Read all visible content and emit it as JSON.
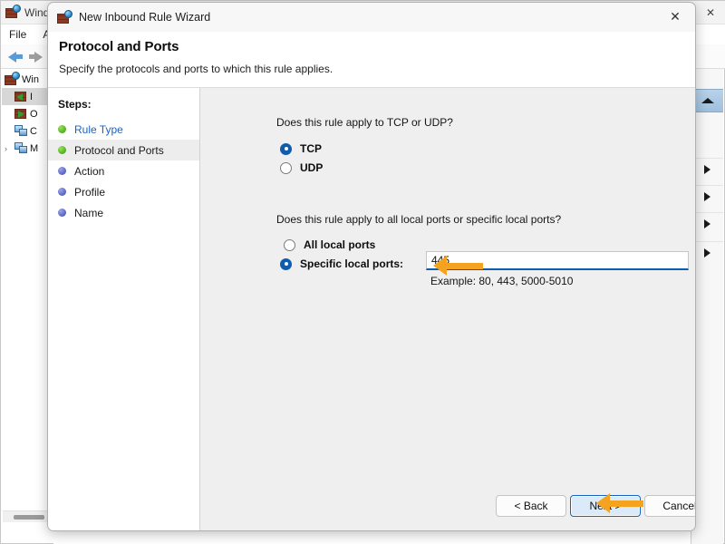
{
  "console": {
    "title": "Wind",
    "icon": "firewall-icon",
    "close_label": "✕",
    "menus": [
      "File",
      "A"
    ],
    "nav": {
      "back": "back-arrow-icon",
      "forward": "forward-arrow-icon"
    },
    "tree": {
      "root": "Win",
      "nodes": [
        {
          "label": "I",
          "icon": "inbound-rules-icon",
          "selected": true,
          "expander": ""
        },
        {
          "label": "O",
          "icon": "outbound-rules-icon",
          "selected": false,
          "expander": ""
        },
        {
          "label": "C",
          "icon": "connection-security-icon",
          "selected": false,
          "expander": ""
        },
        {
          "label": "M",
          "icon": "monitoring-icon",
          "selected": false,
          "expander": "›"
        }
      ]
    },
    "actions_pane": {
      "scroll_up": "scroll-up-icon",
      "section_toggles": [
        "expand-icon",
        "expand-icon",
        "expand-icon",
        "expand-icon"
      ]
    }
  },
  "wizard": {
    "title": "New Inbound Rule Wizard",
    "title_icon": "firewall-icon",
    "close_label": "✕",
    "header": {
      "title": "Protocol and Ports",
      "subtitle": "Specify the protocols and ports to which this rule applies."
    },
    "steps": {
      "label": "Steps:",
      "items": [
        {
          "label": "Rule Type",
          "state": "done",
          "link": true,
          "current": false
        },
        {
          "label": "Protocol and Ports",
          "state": "done",
          "link": false,
          "current": true
        },
        {
          "label": "Action",
          "state": "todo",
          "link": false,
          "current": false
        },
        {
          "label": "Profile",
          "state": "todo",
          "link": false,
          "current": false
        },
        {
          "label": "Name",
          "state": "todo",
          "link": false,
          "current": false
        }
      ]
    },
    "protocol": {
      "question": "Does this rule apply to TCP or UDP?",
      "options": [
        {
          "label": "TCP",
          "selected": true
        },
        {
          "label": "UDP",
          "selected": false
        }
      ]
    },
    "ports": {
      "question": "Does this rule apply to all local ports or specific local ports?",
      "options": [
        {
          "label": "All local ports",
          "selected": false
        },
        {
          "label": "Specific local ports:",
          "selected": true
        }
      ],
      "input_value": "445",
      "input_placeholder": "",
      "example": "Example: 80, 443, 5000-5010"
    },
    "footer": {
      "back": "< Back",
      "next": "Next >",
      "cancel": "Cancel"
    },
    "annotations": {
      "arrow_port": "left-arrow-annotation",
      "arrow_next": "left-arrow-annotation",
      "color": "#f5a21e"
    }
  }
}
